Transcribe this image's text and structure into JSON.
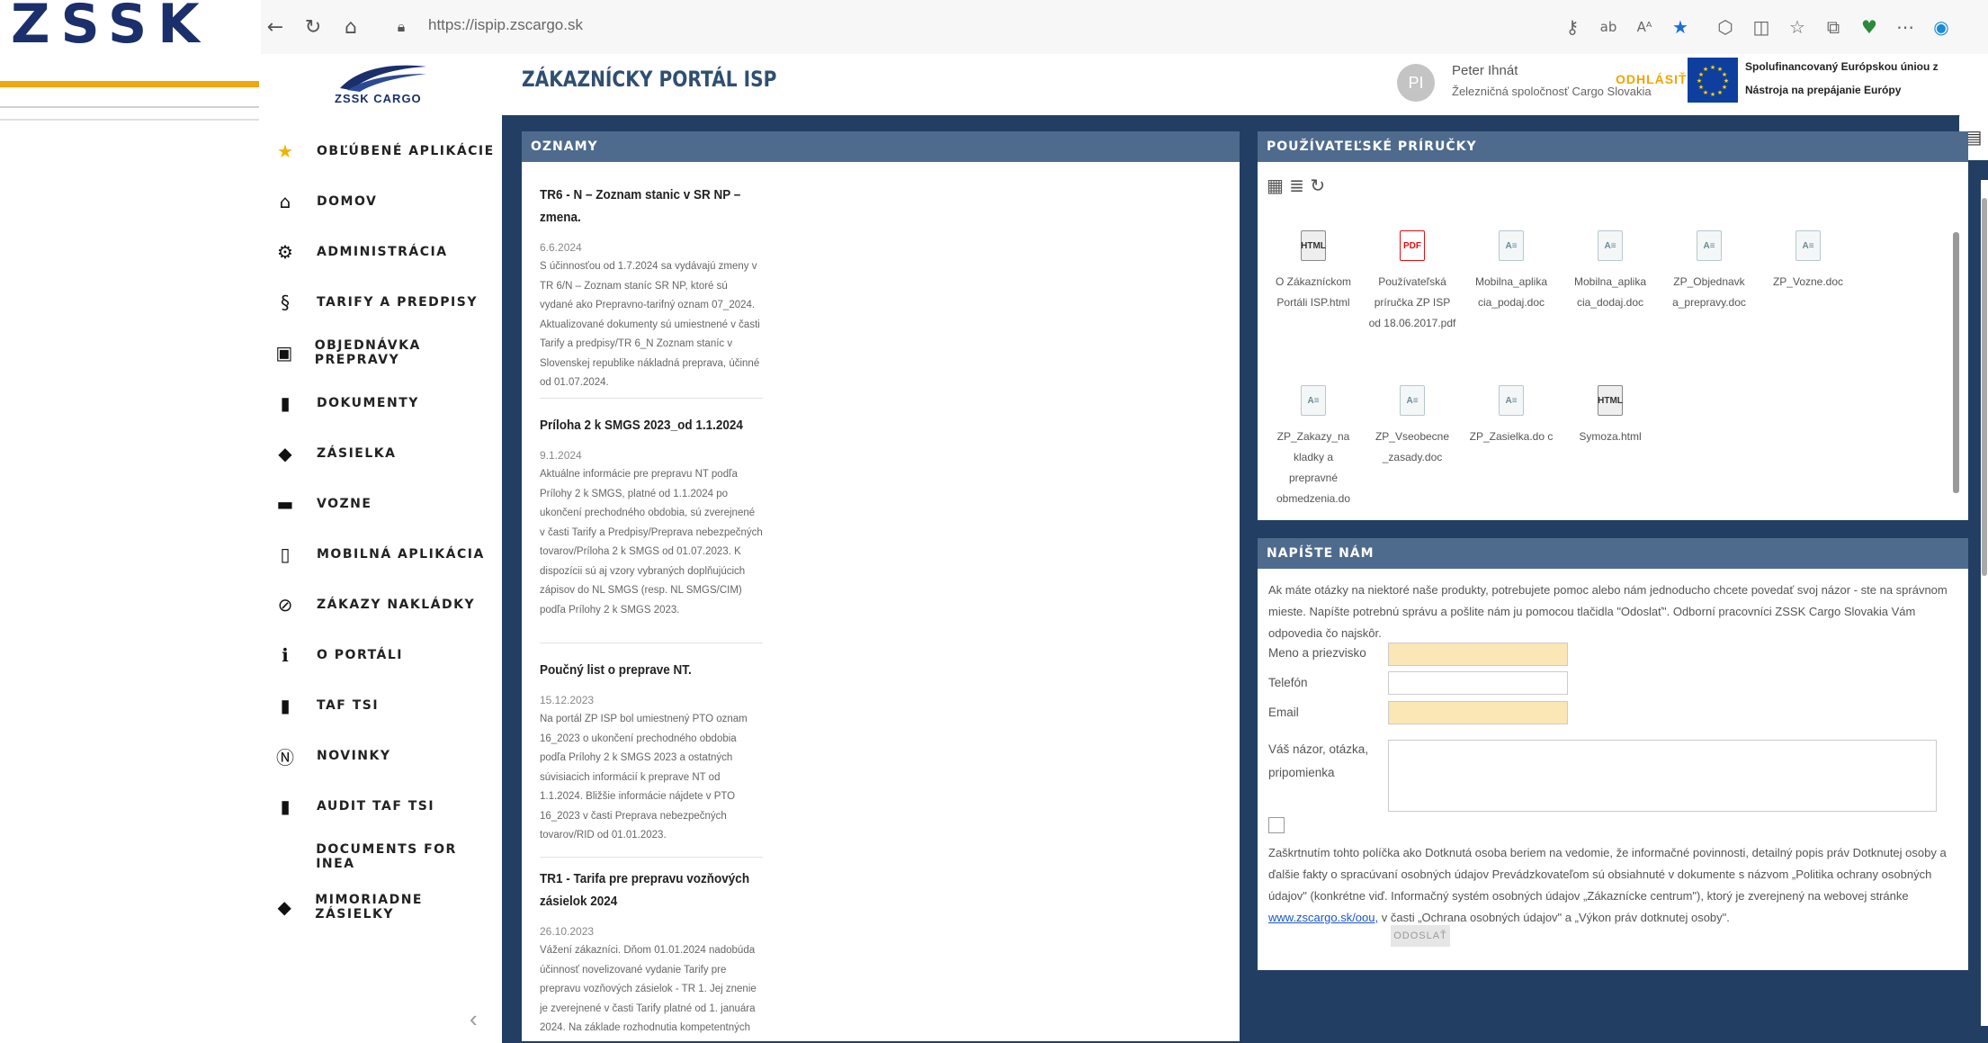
{
  "brand": {
    "big_logo": "ZSSK",
    "small_logo": "ZSSK CARGO"
  },
  "browser": {
    "url": "https://ispip.zscargo.sk",
    "read_aloud": "ab",
    "text_size": "Aᴬ"
  },
  "header": {
    "title": "ZÁKAZNÍCKY PORTÁL ISP",
    "avatar_initials": "PI",
    "user_name": "Peter Ihnát",
    "user_org": "Železničná spoločnosť Cargo Slovakia",
    "logout": "ODHLÁSIŤ",
    "eu_line1": "Spolufinancovaný Európskou úniou z",
    "eu_line2": "Nástroja na prepájanie Európy"
  },
  "nav": [
    {
      "icon": "★",
      "label": "OBĽÚBENÉ APLIKÁCIE"
    },
    {
      "icon": "⌂",
      "label": "DOMOV"
    },
    {
      "icon": "⚙",
      "label": "ADMINISTRÁCIA"
    },
    {
      "icon": "§",
      "label": "TARIFY A PREDPISY"
    },
    {
      "icon": "▣",
      "label": "OBJEDNÁVKA PREPRAVY"
    },
    {
      "icon": "▮",
      "label": "DOKUMENTY"
    },
    {
      "icon": "◆",
      "label": "ZÁSIELKA"
    },
    {
      "icon": "▬",
      "label": "VOZNE"
    },
    {
      "icon": "▯",
      "label": "MOBILNÁ APLIKÁCIA"
    },
    {
      "icon": "⊘",
      "label": "ZÁKAZY NAKLÁDKY"
    },
    {
      "icon": "ℹ",
      "label": "O PORTÁLI"
    },
    {
      "icon": "▮",
      "label": "TAF TSI"
    },
    {
      "icon": "Ⓝ",
      "label": "NOVINKY"
    },
    {
      "icon": "▮",
      "label": "AUDIT TAF TSI"
    },
    {
      "icon": "",
      "label": "DOCUMENTS FOR INEA"
    },
    {
      "icon": "◆",
      "label": "MIMORIADNE ZÁSIELKY"
    }
  ],
  "oznamy": {
    "title": "OZNAMY",
    "items": [
      {
        "title": "TR6 - N – Zoznam stanic v SR NP – zmena.",
        "date": "6.6.2024",
        "body": "S účinnosťou od 1.7.2024 sa vydávajú zmeny v TR 6/N – Zoznam staníc SR NP, ktoré sú vydané ako Prepravno-tarifný oznam 07_2024. Aktualizované dokumenty sú umiestnené v časti Tarify a predpisy/TR 6_N Zoznam staníc v Slovenskej republike nákladná preprava, účinné od 01.07.2024."
      },
      {
        "title": "Príloha 2 k SMGS 2023_od 1.1.2024",
        "date": "9.1.2024",
        "body": "Aktuálne informácie pre prepravu NT podľa Prílohy 2 k SMGS, platné od 1.1.2024 po ukončení prechodného obdobia, sú zverejnené v časti Tarify a Predpisy/Preprava nebezpečných tovarov/Príloha 2 k SMGS od 01.07.2023. K dispozícii sú aj vzory vybraných doplňujúcich zápisov do NL SMGS (resp. NL SMGS/CIM) podľa Prílohy 2 k SMGS 2023."
      },
      {
        "title": "Poučný list o preprave NT.",
        "date": "15.12.2023",
        "body": "Na portál ZP ISP bol umiestnený PTO oznam 16_2023 o ukončení prechodného obdobia podľa Prílohy 2 k SMGS 2023 a ostatných súvisiacich informácií k preprave NT od 1.1.2024. Bližšie informácie nájdete v PTO 16_2023 v časti Preprava nebezpečných tovarov/RID od 01.01.2023."
      },
      {
        "title": "TR1 - Tarifa pre prepravu vozňových zásielok 2024",
        "date": "26.10.2023",
        "body": "Vážení zákazníci. Dňom 01.01.2024 nadobúda účinnosť novelizované vydanie Tarify pre prepravu vozňových zásielok - TR 1. Jej znenie je zverejnené v časti Tarify platné od 1. januára 2024. Na základe rozhodnutia kompetentných orgánov našej"
      }
    ]
  },
  "prirucky": {
    "title": "POUŽÍVATEĽSKÉ PRÍRUČKY",
    "files": [
      {
        "type": "html",
        "name": "O Zákazníckom Portáli ISP.html"
      },
      {
        "type": "pdf",
        "name": "Používateľská príručka ZP ISP od 18.06.2017.pdf"
      },
      {
        "type": "doc",
        "name": "Mobilna_aplika cia_podaj.doc"
      },
      {
        "type": "doc",
        "name": "Mobilna_aplika cia_dodaj.doc"
      },
      {
        "type": "doc",
        "name": "ZP_Objednavk a_prepravy.doc"
      },
      {
        "type": "doc",
        "name": "ZP_Vozne.doc"
      },
      {
        "type": "doc",
        "name": "ZP_Zakazy_na kladky a prepravné obmedzenia.do"
      },
      {
        "type": "doc",
        "name": "ZP_Vseobecne _zasady.doc"
      },
      {
        "type": "doc",
        "name": "ZP_Zasielka.do c"
      },
      {
        "type": "html",
        "name": "Symoza.html"
      }
    ]
  },
  "napiste": {
    "title": "NAPÍŠTE NÁM",
    "intro": "Ak máte otázky na niektoré naše produkty, potrebujete pomoc alebo nám jednoducho chcete povedať svoj názor - ste na správnom mieste. Napíšte potrebnú správu a pošlite nám ju pomocou tlačidla \"Odoslať\". Odborní pracovníci ZSSK Cargo Slovakia Vám odpovedia čo najskôr.",
    "label_name": "Meno a priezvisko",
    "label_phone": "Telefón",
    "label_email": "Email",
    "label_msg": "Váš názor, otázka, pripomienka",
    "consent": "Zaškrtnutím tohto políčka ako Dotknutá osoba beriem na vedomie, že informačné povinnosti, detailný popis práv Dotknutej osoby a ďalšie fakty o spracúvaní osobných údajov Prevádzkovateľom sú obsiahnuté v dokumente s názvom „Politika ochrany osobných údajov\" (konkrétne viď. Informačný systém osobných údajov „Zákaznícke centrum\"), ktorý je zverejnený na webovej stránke",
    "consent_link": "www.zscargo.sk/oou,",
    "consent_tail": "v časti „Ochrana osobných údajov\" a „Výkon práv dotknutej osoby\".",
    "send": "ODOSLAŤ"
  }
}
